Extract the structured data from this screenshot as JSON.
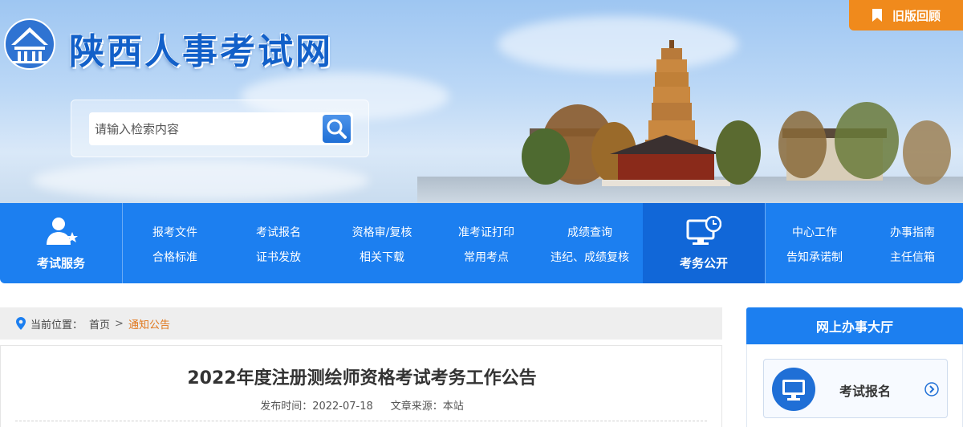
{
  "header": {
    "site_title": "陕西人事考试网",
    "old_version_label": "旧版回顾",
    "search": {
      "placeholder": "请输入检索内容"
    },
    "icons": {
      "logo": "pagoda-logo-icon",
      "search": "search-icon",
      "bookmark": "bookmark-icon"
    }
  },
  "nav": {
    "exam_service": {
      "label": "考试服务",
      "icon": "user-star-icon"
    },
    "service_links": [
      {
        "label": "报考文件"
      },
      {
        "label": "合格标准"
      },
      {
        "label": "考试报名"
      },
      {
        "label": "证书发放"
      },
      {
        "label": "资格审/复核"
      },
      {
        "label": "相关下载"
      },
      {
        "label": "准考证打印"
      },
      {
        "label": "常用考点"
      },
      {
        "label": "成绩查询"
      },
      {
        "label": "违纪、成绩复核"
      }
    ],
    "exam_public": {
      "label": "考务公开",
      "icon": "monitor-clock-icon"
    },
    "public_links": [
      {
        "label": "中心工作"
      },
      {
        "label": "告知承诺制"
      },
      {
        "label": "办事指南"
      },
      {
        "label": "主任信箱"
      }
    ]
  },
  "breadcrumb": {
    "prefix": "当前位置：",
    "home": "首页",
    "separator": ">",
    "current": "通知公告",
    "icon": "location-pin-icon"
  },
  "article": {
    "title": "2022年度注册测绘师资格考试考务工作公告",
    "publish_label": "发布时间：",
    "publish_date": "2022-07-18",
    "source_label": "文章来源：",
    "source": "本站"
  },
  "sidebar": {
    "title": "网上办事大厅",
    "items": [
      {
        "label": "考试报名",
        "icon": "monitor-icon"
      }
    ]
  },
  "colors": {
    "primary_blue": "#1c7ff0",
    "dark_blue": "#1167d8",
    "orange": "#f08a1c",
    "title_blue": "#1260c9"
  }
}
